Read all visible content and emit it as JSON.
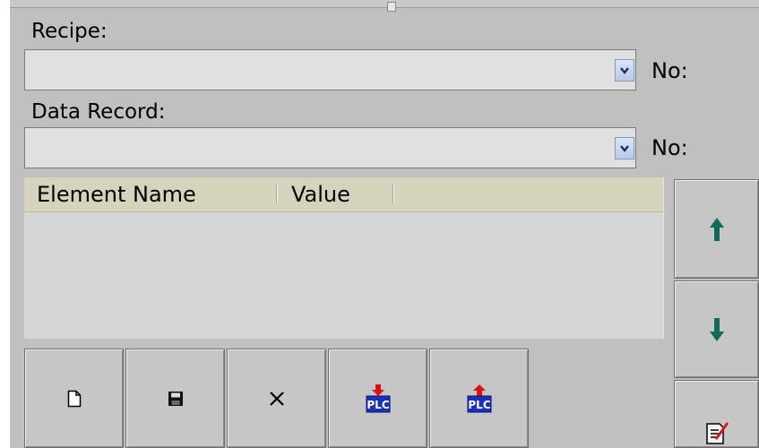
{
  "recipe": {
    "label": "Recipe:",
    "selected": "",
    "no_label": "No:"
  },
  "data_record": {
    "label": "Data Record:",
    "selected": "",
    "no_label": "No:"
  },
  "table": {
    "columns": [
      "Element Name",
      "Value"
    ],
    "rows": []
  },
  "side_buttons": [
    {
      "icon": "arrow-up-icon"
    },
    {
      "icon": "arrow-down-icon"
    },
    {
      "icon": "edit-document-icon"
    }
  ],
  "bottom_buttons": [
    {
      "icon": "new-document-icon"
    },
    {
      "icon": "save-icon"
    },
    {
      "icon": "delete-icon"
    },
    {
      "icon": "plc-download-icon",
      "text": "PLC"
    },
    {
      "icon": "plc-upload-icon",
      "text": "PLC"
    }
  ],
  "colors": {
    "background": "#c0c0c0",
    "arrow": "#0e6b5c",
    "plc_blue": "#1b2fbf",
    "plc_red": "#e01010"
  }
}
